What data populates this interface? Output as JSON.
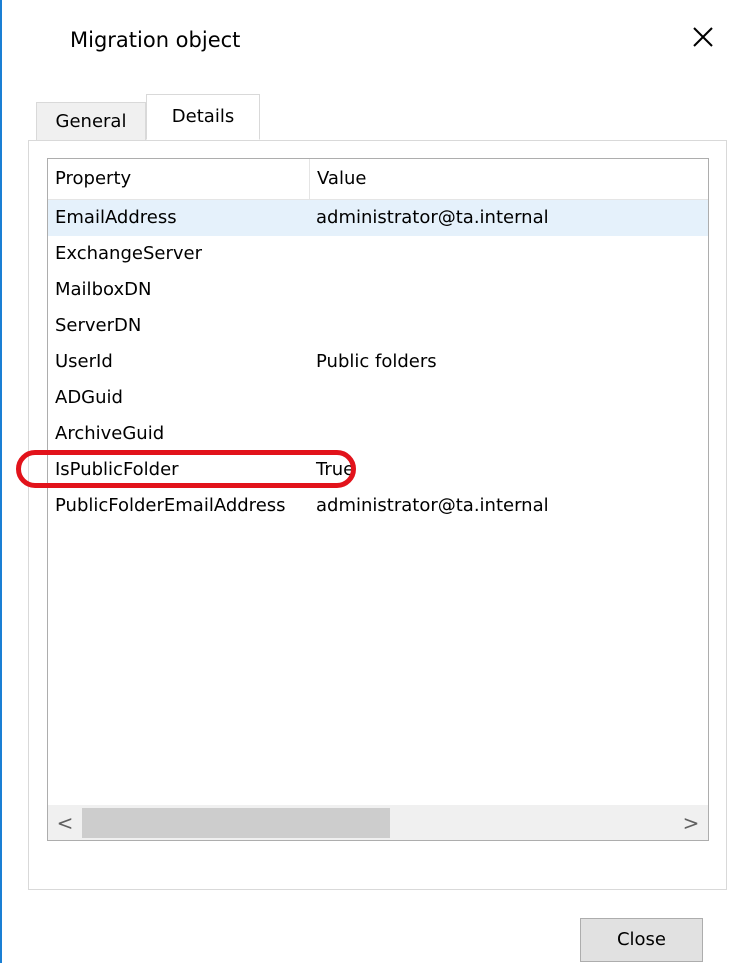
{
  "dialog": {
    "title": "Migration object",
    "close_icon": "close-icon"
  },
  "tabs": [
    {
      "label": "General",
      "active": false
    },
    {
      "label": "Details",
      "active": true
    }
  ],
  "listview": {
    "columns": [
      "Property",
      "Value"
    ],
    "rows": [
      {
        "property": "EmailAddress",
        "value": "administrator@ta.internal",
        "selected": true
      },
      {
        "property": "ExchangeServer",
        "value": ""
      },
      {
        "property": "MailboxDN",
        "value": ""
      },
      {
        "property": "ServerDN",
        "value": ""
      },
      {
        "property": "UserId",
        "value": "Public folders"
      },
      {
        "property": "ADGuid",
        "value": ""
      },
      {
        "property": "ArchiveGuid",
        "value": ""
      },
      {
        "property": "IsPublicFolder",
        "value": "True",
        "highlighted": true
      },
      {
        "property": "PublicFolderEmailAddress",
        "value": "administrator@ta.internal"
      }
    ],
    "scrollbar": {
      "left_arrow": "<",
      "right_arrow": ">"
    }
  },
  "buttons": {
    "close_label": "Close"
  },
  "colors": {
    "accent_border": "#1a7fd4",
    "selected_row": "#e5f1fb",
    "highlight_oval": "#e2131b"
  }
}
